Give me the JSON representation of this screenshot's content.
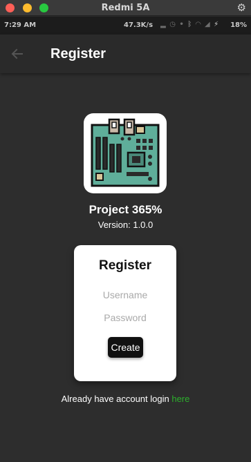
{
  "window": {
    "title": "Redmi 5A",
    "settings_icon": "gear-icon"
  },
  "status_bar": {
    "time": "7:29 AM",
    "network_speed": "47.3K/s",
    "battery": "18%"
  },
  "app_bar": {
    "title": "Register",
    "back_icon": "arrow-left-icon"
  },
  "branding": {
    "logo_icon": "motherboard-icon",
    "project_name": "Project 365%",
    "version": "Version: 1.0.0"
  },
  "form": {
    "title": "Register",
    "username_placeholder": "Username",
    "password_placeholder": "Password",
    "create_label": "Create"
  },
  "footer": {
    "prompt": "Already have account login ",
    "link": "here"
  },
  "colors": {
    "background": "#2d2d2d",
    "link": "#2cb02c",
    "card": "#ffffff",
    "button": "#111111"
  }
}
